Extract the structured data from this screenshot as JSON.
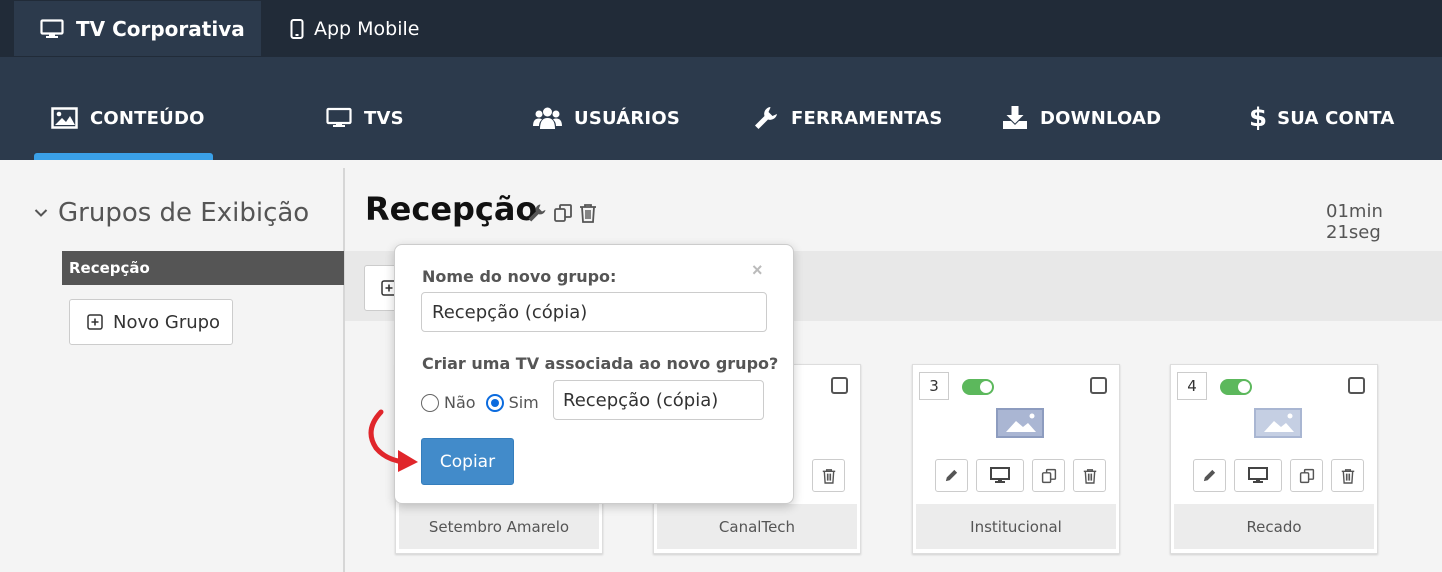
{
  "topbar": {
    "tabs": [
      {
        "label": "TV Corporativa",
        "icon": "monitor-icon",
        "active": true
      },
      {
        "label": "App Mobile",
        "icon": "phone-icon",
        "active": false
      }
    ]
  },
  "nav": {
    "items": [
      {
        "label": "CONTEÚDO",
        "icon": "image-icon"
      },
      {
        "label": "TVS",
        "icon": "monitor-icon"
      },
      {
        "label": "USUÁRIOS",
        "icon": "users-icon"
      },
      {
        "label": "FERRAMENTAS",
        "icon": "wrench-icon"
      },
      {
        "label": "DOWNLOAD",
        "icon": "download-icon"
      },
      {
        "label": "SUA CONTA",
        "icon": "dollar-icon"
      }
    ],
    "accent": "#3aa0e8"
  },
  "sidebar": {
    "heading": "Grupos de Exibição",
    "groups": [
      "Recepção"
    ],
    "new_group_label": "Novo Grupo"
  },
  "main": {
    "title": "Recepção",
    "duration": "01min 21seg"
  },
  "cards": [
    {
      "number": "",
      "name": "Setembro Amarelo"
    },
    {
      "number": "",
      "name": "CanalTech"
    },
    {
      "number": "3",
      "name": "Institucional"
    },
    {
      "number": "4",
      "name": "Recado"
    }
  ],
  "popover": {
    "name_label": "Nome do novo grupo:",
    "name_value": "Recepção (cópia)",
    "tv_question": "Criar uma TV associada ao novo grupo?",
    "option_no": "Não",
    "option_yes": "Sim",
    "selected_option": "Sim",
    "tv_name_value": "Recepção (cópia)",
    "copy_label": "Copiar",
    "close_glyph": "×"
  },
  "colors": {
    "topbar_bg": "#212b38",
    "nav_bg": "#2c3a4c",
    "primary_button": "#428bca",
    "toggle_on": "#5cb85c",
    "arrow": "#e0262b"
  }
}
